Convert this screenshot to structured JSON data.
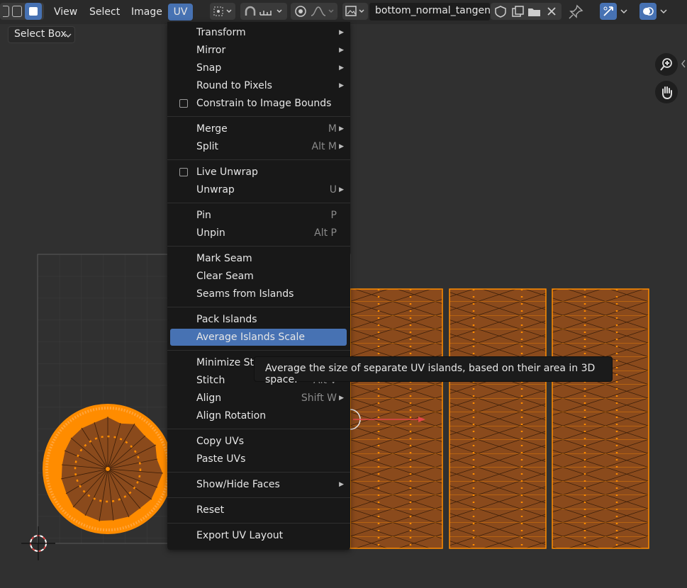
{
  "header": {
    "menus": [
      "View",
      "Select",
      "Image",
      "UV"
    ],
    "image_name": "bottom_normal_tangent"
  },
  "toolbar": {
    "select_mode": "Select Box"
  },
  "uv_menu": {
    "items": [
      {
        "label": "Transform",
        "shortcut": "",
        "submenu": true,
        "checkbox": false
      },
      {
        "label": "Mirror",
        "shortcut": "",
        "submenu": true,
        "checkbox": false
      },
      {
        "label": "Snap",
        "shortcut": "",
        "submenu": true,
        "checkbox": false
      },
      {
        "label": "Round to Pixels",
        "shortcut": "",
        "submenu": true,
        "checkbox": false
      },
      {
        "label": "Constrain to Image Bounds",
        "shortcut": "",
        "submenu": false,
        "checkbox": true
      },
      {
        "label": "Merge",
        "shortcut": "M",
        "submenu": true,
        "checkbox": false
      },
      {
        "label": "Split",
        "shortcut": "Alt M",
        "submenu": true,
        "checkbox": false
      },
      {
        "label": "Live Unwrap",
        "shortcut": "",
        "submenu": false,
        "checkbox": true
      },
      {
        "label": "Unwrap",
        "shortcut": "U",
        "submenu": true,
        "checkbox": false
      },
      {
        "label": "Pin",
        "shortcut": "P",
        "submenu": false,
        "checkbox": false
      },
      {
        "label": "Unpin",
        "shortcut": "Alt P",
        "submenu": false,
        "checkbox": false
      },
      {
        "label": "Mark Seam",
        "shortcut": "",
        "submenu": false,
        "checkbox": false
      },
      {
        "label": "Clear Seam",
        "shortcut": "",
        "submenu": false,
        "checkbox": false
      },
      {
        "label": "Seams from Islands",
        "shortcut": "",
        "submenu": false,
        "checkbox": false
      },
      {
        "label": "Pack Islands",
        "shortcut": "",
        "submenu": false,
        "checkbox": false
      },
      {
        "label": "Average Islands Scale",
        "shortcut": "",
        "submenu": false,
        "checkbox": false
      },
      {
        "label": "Minimize Stre",
        "shortcut": "",
        "submenu": false,
        "checkbox": false
      },
      {
        "label": "Stitch",
        "shortcut": "Alt V",
        "submenu": false,
        "checkbox": false
      },
      {
        "label": "Align",
        "shortcut": "Shift W",
        "submenu": true,
        "checkbox": false
      },
      {
        "label": "Align Rotation",
        "shortcut": "",
        "submenu": false,
        "checkbox": false
      },
      {
        "label": "Copy UVs",
        "shortcut": "",
        "submenu": false,
        "checkbox": false
      },
      {
        "label": "Paste UVs",
        "shortcut": "",
        "submenu": false,
        "checkbox": false
      },
      {
        "label": "Show/Hide Faces",
        "shortcut": "",
        "submenu": true,
        "checkbox": false
      },
      {
        "label": "Reset",
        "shortcut": "",
        "submenu": false,
        "checkbox": false
      },
      {
        "label": "Export UV Layout",
        "shortcut": "",
        "submenu": false,
        "checkbox": false
      }
    ],
    "highlighted": "Average Islands Scale"
  },
  "tooltip": {
    "text": "Average the size of separate UV islands, based on their area in 3D space."
  },
  "colors": {
    "accent": "#4772b3",
    "uv_edge": "#ff8c00",
    "uv_face": "#8a4a1c",
    "background": "#303030"
  }
}
